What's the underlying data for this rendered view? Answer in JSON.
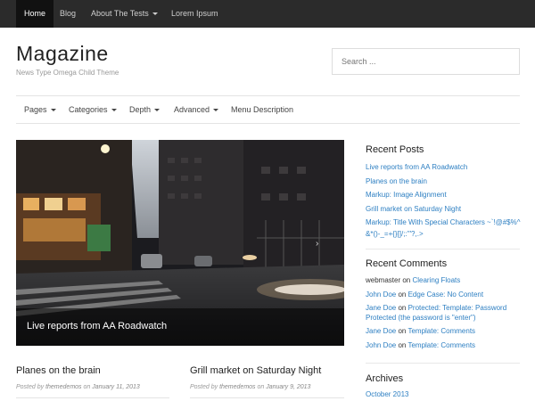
{
  "topnav": {
    "items": [
      {
        "label": "Home",
        "active": true
      },
      {
        "label": "Blog"
      },
      {
        "label": "About The Tests",
        "dropdown": true
      },
      {
        "label": "Lorem Ipsum"
      }
    ]
  },
  "header": {
    "title": "Magazine",
    "description": "News Type Omega Child Theme",
    "search_placeholder": "Search ..."
  },
  "subnav": {
    "items": [
      {
        "label": "Pages",
        "dropdown": true
      },
      {
        "label": "Categories",
        "dropdown": true
      },
      {
        "label": "Depth",
        "dropdown": true
      },
      {
        "label": "Advanced",
        "dropdown": true
      },
      {
        "label": "Menu Description"
      }
    ]
  },
  "featured": {
    "caption": "Live reports from AA Roadwatch",
    "next_icon": "chevron-right-icon"
  },
  "posts": [
    {
      "title": "Planes on the brain",
      "meta_prefix": "Posted by ",
      "author": "themedemos",
      "meta_mid": " on ",
      "date": "January 11, 2013"
    },
    {
      "title": "Grill market on Saturday Night",
      "meta_prefix": "Posted by ",
      "author": "themedemos",
      "meta_mid": " on ",
      "date": "January 9, 2013"
    }
  ],
  "sidebar": {
    "recent_posts_title": "Recent Posts",
    "recent_posts": [
      "Live reports from AA Roadwatch",
      "Planes on the brain",
      "Markup: Image Alignment",
      "Grill market on Saturday Night",
      "Markup: Title With Special Characters ~`!@#$%^&*()-_=+{}[]/;:'\"?,.>"
    ],
    "recent_comments_title": "Recent Comments",
    "recent_comments": [
      {
        "author": "webmaster",
        "on": " on ",
        "post": "Clearing Floats"
      },
      {
        "author": "John Doe",
        "on": " on ",
        "post": "Edge Case: No Content"
      },
      {
        "author": "Jane Doe",
        "on": " on ",
        "post": "Protected: Template: Password Protected (the password is \"enter\")"
      },
      {
        "author": "Jane Doe",
        "on": " on ",
        "post": "Template: Comments"
      },
      {
        "author": "John Doe",
        "on": " on ",
        "post": "Template: Comments"
      }
    ],
    "archives_title": "Archives",
    "archives": [
      "October 2013"
    ]
  },
  "colors": {
    "topbar": "#2b2b2b",
    "link": "#2d7fc2"
  }
}
